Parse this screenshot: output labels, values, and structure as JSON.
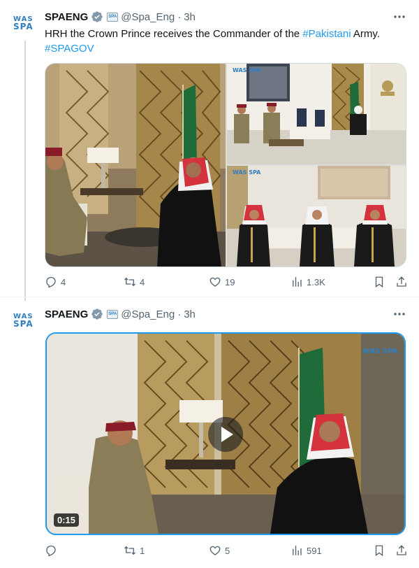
{
  "account": {
    "name": "SPAENG",
    "handle": "@Spa_Eng",
    "separator": "·",
    "logo_line1": "WAS",
    "logo_line2": "SPA"
  },
  "colors": {
    "link": "#1d9bf0",
    "muted": "#536471",
    "verified": "#829aab",
    "logo": "#2f7fc1"
  },
  "tweets": [
    {
      "time": "3h",
      "text": {
        "part1": "HRH the Crown Prince receives the Commander of the ",
        "hashtag1": "#Pakistani",
        "part2": " Army.",
        "hashtag2": "#SPAGOV"
      },
      "media": {
        "type": "photo-grid",
        "watermark": "WAS SPA"
      },
      "stats": {
        "replies": "4",
        "retweets": "4",
        "likes": "19",
        "views": "1.3K"
      }
    },
    {
      "time": "3h",
      "media": {
        "type": "video",
        "duration": "0:15",
        "watermark": "WAS SPA"
      },
      "stats": {
        "replies": "",
        "retweets": "1",
        "likes": "5",
        "views": "591"
      }
    }
  ],
  "icons": {
    "more": "more-dots-icon",
    "verified": "verified-badge-icon",
    "affiliation": "affiliation-badge-icon",
    "reply": "reply-icon",
    "retweet": "retweet-icon",
    "like": "heart-icon",
    "views": "views-chart-icon",
    "bookmark": "bookmark-icon",
    "share": "share-icon",
    "play": "play-icon"
  }
}
